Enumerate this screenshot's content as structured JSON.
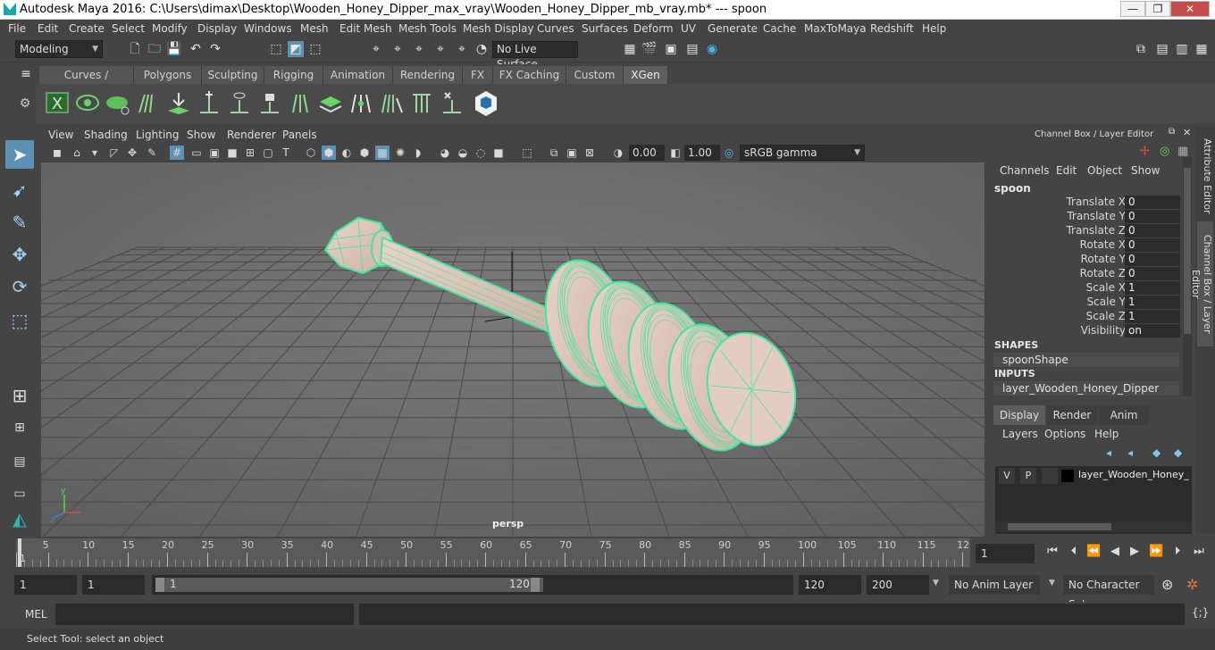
{
  "window": {
    "title": "Autodesk Maya 2016: C:\\Users\\dimax\\Desktop\\Wooden_Honey_Dipper_max_vray\\Wooden_Honey_Dipper_mb_vray.mb*   ---   spoon",
    "minimize": "—",
    "restore": "❐",
    "close": "✕"
  },
  "menubar": [
    "File",
    "Edit",
    "Create",
    "Select",
    "Modify",
    "Display",
    "Windows",
    "Mesh",
    "Edit Mesh",
    "Mesh Tools",
    "Mesh Display",
    "Curves",
    "Surfaces",
    "Deform",
    "UV",
    "Generate",
    "Cache",
    "MaxToMaya",
    "Redshift",
    "Help"
  ],
  "statusline": {
    "mode": "Modeling",
    "live_surface": "No Live Surface"
  },
  "shelf_tabs": [
    "Curves / Surfaces",
    "Polygons",
    "Sculpting",
    "Rigging",
    "Animation",
    "Rendering",
    "FX",
    "FX Caching",
    "Custom",
    "XGen"
  ],
  "active_shelf_tab": "XGen",
  "viewport": {
    "menu": [
      "View",
      "Shading",
      "Lighting",
      "Show",
      "Renderer",
      "Panels"
    ],
    "exposure": "0.00",
    "gamma": "1.00",
    "colorspace": "sRGB gamma",
    "camera_label": "persp"
  },
  "channel_box": {
    "title": "Channel Box / Layer Editor",
    "menu": [
      "Channels",
      "Edit",
      "Object",
      "Show"
    ],
    "object": "spoon",
    "attributes": [
      {
        "label": "Translate X",
        "value": "0"
      },
      {
        "label": "Translate Y",
        "value": "0"
      },
      {
        "label": "Translate Z",
        "value": "0"
      },
      {
        "label": "Rotate X",
        "value": "0"
      },
      {
        "label": "Rotate Y",
        "value": "0"
      },
      {
        "label": "Rotate Z",
        "value": "0"
      },
      {
        "label": "Scale X",
        "value": "1"
      },
      {
        "label": "Scale Y",
        "value": "1"
      },
      {
        "label": "Scale Z",
        "value": "1"
      },
      {
        "label": "Visibility",
        "value": "on"
      }
    ],
    "shapes_header": "SHAPES",
    "shape": "spoonShape",
    "inputs_header": "INPUTS",
    "input": "layer_Wooden_Honey_Dipper"
  },
  "layer_editor": {
    "tabs": [
      "Display",
      "Render",
      "Anim"
    ],
    "menu": [
      "Layers",
      "Options",
      "Help"
    ],
    "layer": {
      "v": "V",
      "p": "P",
      "name": "layer_Wooden_Honey_D"
    }
  },
  "side_tabs": [
    "Attribute Editor",
    "Channel Box / Layer Editor"
  ],
  "timeline": {
    "ticks": [
      "5",
      "10",
      "15",
      "20",
      "25",
      "30",
      "35",
      "40",
      "45",
      "50",
      "55",
      "60",
      "65",
      "70",
      "75",
      "80",
      "85",
      "90",
      "95",
      "100",
      "105",
      "110",
      "115",
      "12"
    ],
    "first_tick": "1",
    "current_frame": "1"
  },
  "range": {
    "start": "1",
    "playback_start": "1",
    "slider_start": "1",
    "slider_end": "120",
    "playback_end": "120",
    "end": "200",
    "anim_layer": "No Anim Layer",
    "character_set": "No Character Set"
  },
  "command": {
    "language": "MEL"
  },
  "help_line": "Select Tool: select an object",
  "colors": {
    "accent": "#5e90b3",
    "wireframe": "#3de8a0",
    "mesh": "#d8bcb0"
  }
}
